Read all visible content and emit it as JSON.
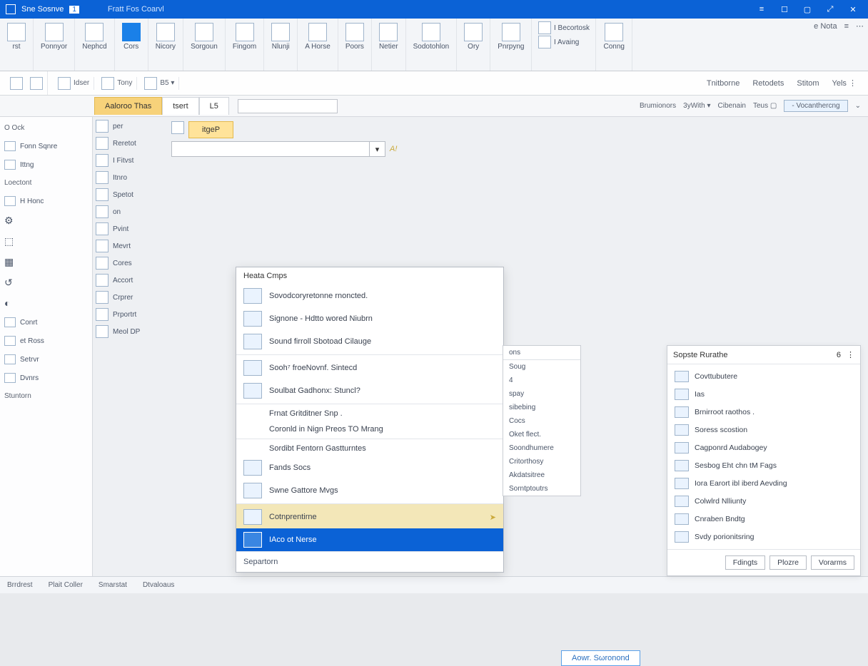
{
  "title": {
    "app": "Sne Sosnve",
    "badge": "1",
    "doc": "Fratt Fos Coarvl"
  },
  "winbtns": {
    "a": "≡",
    "b": "☐",
    "c": "▢",
    "d": "⤢",
    "e": "✕"
  },
  "ribbon": [
    {
      "label": "rst"
    },
    {
      "label": "Ponnyor"
    },
    {
      "label": "Nephcd"
    },
    {
      "label": "Cors",
      "blue": true
    },
    {
      "label": "Nicory"
    },
    {
      "label": "Sorgoun"
    },
    {
      "label": "Fingom"
    },
    {
      "label": "Nlunji"
    },
    {
      "label": "A Horse"
    },
    {
      "label": "Poors"
    },
    {
      "label": "Netier"
    },
    {
      "label": "Sodotohlon"
    },
    {
      "label": "Ory"
    },
    {
      "label": "Pnrpyng"
    }
  ],
  "ribbon_right_a": [
    "I Becortosk",
    "I Avaing"
  ],
  "ribbon_right_b": "Conng",
  "ribbon_far": [
    "e Nota",
    "≡",
    "⋯"
  ],
  "toolbar2_left": [
    {
      "t": "Idser"
    },
    {
      "t": "Tony"
    },
    {
      "t": "B5 ▾"
    }
  ],
  "toolbar2_right": [
    "Tnitborne",
    "Retodets",
    "Stitom",
    "Yels ⋮"
  ],
  "tabs": {
    "active": "Aaloroo Thas",
    "others": [
      "tsert",
      "L5"
    ]
  },
  "formula_row": {
    "left_groups": [
      "Brumionors",
      "3yWith ▾",
      "Cibenain",
      "Teus ▢"
    ],
    "right_pill": "- Vocanthercng",
    "right_icon": "⌄"
  },
  "sidebar": {
    "groups": [
      {
        "title": "O Ock",
        "items": [
          "Fonn Sqnre",
          "Ittng"
        ]
      },
      {
        "title": "Loectont",
        "items": [
          "H Honc"
        ]
      },
      {
        "plain_items": [
          "⚙",
          "⬚",
          "▦",
          "↺",
          "◐"
        ]
      },
      {
        "items": [
          "Conrt",
          "et Ross",
          "Setrvr",
          "Dvnrs"
        ]
      },
      {
        "title": "Stuntorn"
      }
    ]
  },
  "tree": [
    "per",
    "Reretot",
    "I Fitvst",
    "Itnro",
    "Spetot",
    "on",
    "Pvint",
    "Mevrt",
    "Cores",
    "Accort",
    "Crprer",
    "Prportrt",
    "Meol DP"
  ],
  "yellow": {
    "tab": "itgeP",
    "aux": "A!"
  },
  "popup": {
    "title": "Heata Cmps",
    "items": [
      {
        "t": "Sovodcoryretonne rnoncted.",
        "thumb": true
      },
      {
        "t": "Signone - Hdtto wored Niubrn",
        "thumb": true
      },
      {
        "t": "Sound firroll Sbotoad Cilauge",
        "thumb": true
      },
      {
        "t": "Sooh⁷ froeNovnf. Sintecd",
        "thumb": true,
        "sep": true
      },
      {
        "t": "Soulbat Gadhonx: Stuncl?",
        "thumb": true
      },
      {
        "t": "Frnat Gritditner Snp .",
        "sep": true
      },
      {
        "t": "Coronld in Nign Preos TO Mrang"
      },
      {
        "t": "Sordibt Fentorn Gastturntes",
        "sep": true
      },
      {
        "t": "Fands Socs",
        "thumb": true
      },
      {
        "t": "Swne Gattore Mvgs",
        "thumb": true
      },
      {
        "t": "Cotnprentirne",
        "thumb": true,
        "sep": true,
        "hover": true,
        "arrow": "➤"
      },
      {
        "t": "IAco ot Nerse",
        "thumb": true,
        "selected": true
      }
    ],
    "footer": "Separtorn"
  },
  "undermenu_title": "ons",
  "undermenu": [
    "Soug",
    "4",
    "spay",
    "sibebing",
    "Cocs",
    "Oket flect.",
    "Soondhumere",
    "Critorthosy",
    "Akdatsitree",
    "Sorntptoutrs"
  ],
  "pane": {
    "title": "Sopste Rurathe",
    "badge": "6",
    "items": [
      "Covttubutere",
      "Ias",
      "Brnirroot raothos .",
      "Soress scostion",
      "Cagponrd Audabogey",
      "Sesbog Eht chn tM Fags",
      "Iora Earort ibl iberd Aevding",
      "Colwlrd Nlliunty",
      "Cnraben Bndtg",
      "Svdy porionitsring"
    ],
    "buttons": [
      "Fdingts",
      "Plozre",
      "Vorarms"
    ]
  },
  "action_pill": "Aowr. Sωronοnd",
  "status": [
    "Brrdrest",
    "Plait Coller",
    "Smarstat",
    "Dtvaloaus"
  ]
}
